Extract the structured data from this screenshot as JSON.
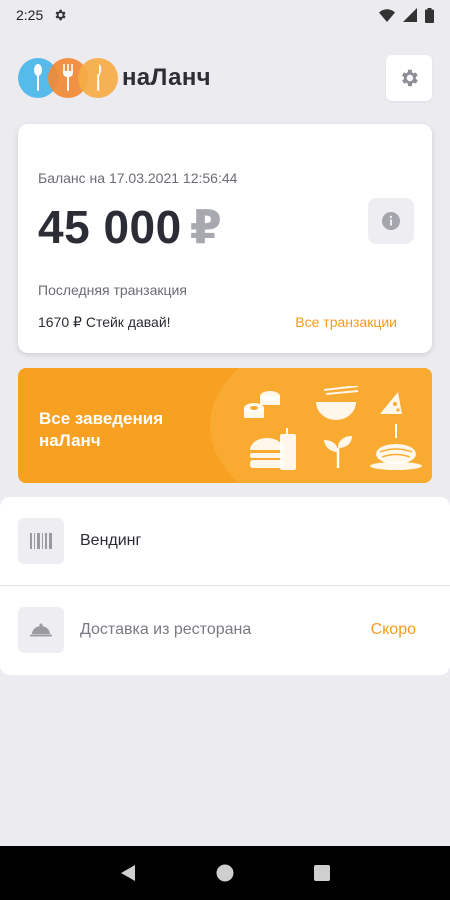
{
  "status_bar": {
    "time": "2:25"
  },
  "header": {
    "brand": "наЛанч"
  },
  "balance": {
    "date_label": "Баланс на 17.03.2021 12:56:44",
    "amount": "45 000",
    "currency": "₽",
    "last_transaction_label": "Последняя транзакция",
    "last_transaction_value": "1670 ₽ Стейк давай!",
    "all_transactions_link": "Все транзакции"
  },
  "banner": {
    "title": "Все заведения наЛанч"
  },
  "options": [
    {
      "label": "Вендинг",
      "icon": "barcode-icon"
    },
    {
      "label": "Доставка из ресторана",
      "icon": "cloche-icon",
      "badge": "Скоро"
    }
  ],
  "colors": {
    "accent": "#f59a1d",
    "banner": "#f7a021",
    "background": "#ecebef"
  }
}
